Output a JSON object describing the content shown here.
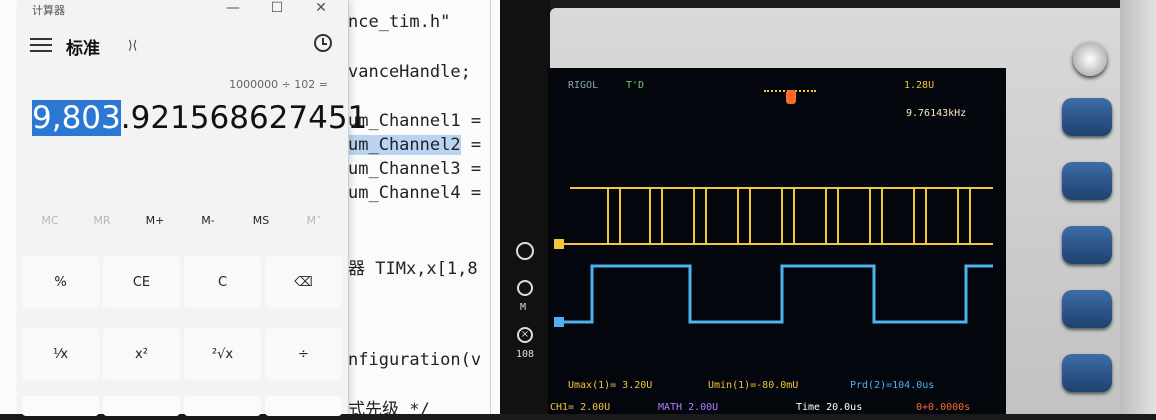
{
  "editor": {
    "lines": [
      "nce_tim.h\"",
      "vanceHandle;",
      "um_Channel1 =",
      "um_Channel2 =",
      "um_Channel3 =",
      "um_Channel4 =",
      "器 TIMx,x[1,8",
      "nfiguration(v",
      "式先级 */"
    ],
    "highlighted_text": "um_Channel2"
  },
  "calculator": {
    "window_title": "计算器",
    "minimize": "—",
    "maximize": "☐",
    "close": "✕",
    "mode": "标准",
    "mode_icon": "⟩⟨",
    "expression": "1000000 ÷ 102 =",
    "result_selected": "9,803",
    "result_rest": ".921568627451",
    "result_prefix": "",
    "memory": [
      "MC",
      "MR",
      "M+",
      "M-",
      "MS",
      "M˅"
    ],
    "keys_row1": [
      "%",
      "CE",
      "C",
      "⌫"
    ],
    "keys_row2": [
      "⅟x",
      "x²",
      "²√x",
      "÷"
    ]
  },
  "scope": {
    "brand": "RIGOL",
    "trigger_status": "T'D",
    "trigger_level": "1.28U",
    "frequency": "9.76143kHz",
    "vmax": "Umax(1)= 3.20U",
    "vmin": "Umin(1)=-80.0mU",
    "period": "Prd(2)=104.0us",
    "ch1_scale": "CH1= 2.00U",
    "math_scale": "MATH 2.00U",
    "time_base": "Time 20.0us",
    "trigger_offset": "0+0.0000s",
    "side_m": "M",
    "side_108": "108",
    "colors": {
      "ch1": "#f2c53a",
      "ch2": "#4eb2f2",
      "accent": "#ff6a2b"
    }
  }
}
